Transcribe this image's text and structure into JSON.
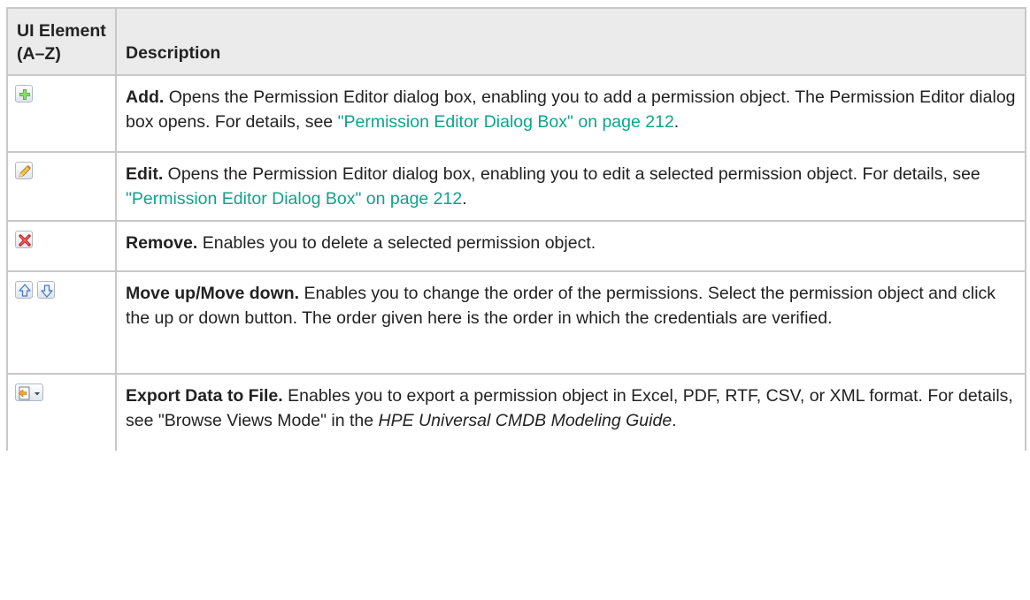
{
  "header": {
    "col1": "UI Element (A–Z)",
    "col2": "Description"
  },
  "rows": [
    {
      "icon": "add-icon",
      "title": "Add.",
      "text1": " Opens the Permission Editor dialog box, enabling you to add a permission object. The Permission Editor dialog box opens. For details, see ",
      "link": "\"Permission Editor Dialog Box\" on page 212",
      "text2": "."
    },
    {
      "icon": "edit-icon",
      "title": "Edit.",
      "text1": " Opens the Permission Editor dialog box, enabling you to edit a selected permission object. For details, see ",
      "link": "\"Permission Editor Dialog Box\" on page 212",
      "text2": "."
    },
    {
      "icon": "remove-icon",
      "title": "Remove.",
      "text1": " Enables you to delete a selected permission object."
    },
    {
      "icon": "move-up-move-down-icons",
      "title": "Move up/Move down.",
      "text1": " Enables you to change the order of the permissions. Select the permission object and click the up or down button. The order given here is the order in which the credentials are verified."
    },
    {
      "icon": "export-icon",
      "title": "Export Data to File.",
      "text1": " Enables you to export a permission object in Excel, PDF, RTF, CSV, or XML format. For details, see \"Browse Views Mode\" in the ",
      "italic": "HPE Universal CMDB Modeling Guide",
      "text2": "."
    }
  ],
  "colors": {
    "link": "#0fa38b",
    "header_bg": "#ebebeb",
    "border": "#c8c8c8"
  }
}
